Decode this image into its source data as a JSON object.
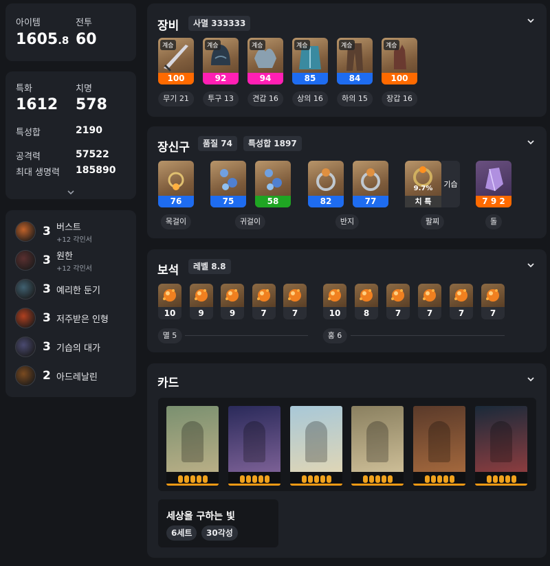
{
  "summary": {
    "item_label": "아이템",
    "item_level": "1605",
    "item_level_decimal": ".8",
    "combat_label": "전투",
    "combat_level": "60"
  },
  "stats": {
    "spec_label": "특화",
    "spec_value": "1612",
    "crit_label": "치명",
    "crit_value": "578",
    "trait_total_label": "특성합",
    "trait_total_value": "2190",
    "attack_label": "공격력",
    "attack_value": "57522",
    "max_hp_label": "최대 생명력",
    "max_hp_value": "185890"
  },
  "engravings": [
    {
      "level": "3",
      "name": "버스트",
      "sub": "+12 각인서",
      "icon": "burst-icon",
      "color": "#c0622a"
    },
    {
      "level": "3",
      "name": "원한",
      "sub": "+12 각인서",
      "icon": "grudge-icon",
      "color": "#5a3030"
    },
    {
      "level": "3",
      "name": "예리한 둔기",
      "sub": "",
      "icon": "keen-blunt-icon",
      "color": "#406070"
    },
    {
      "level": "3",
      "name": "저주받은 인형",
      "sub": "",
      "icon": "cursed-doll-icon",
      "color": "#b04020"
    },
    {
      "level": "3",
      "name": "기습의 대가",
      "sub": "",
      "icon": "ambush-icon",
      "color": "#4a4a70"
    },
    {
      "level": "2",
      "name": "아드레날린",
      "sub": "",
      "icon": "adrenaline-icon",
      "color": "#7a4a20"
    }
  ],
  "equipment": {
    "title": "장비",
    "tag": "사멸 333333",
    "items": [
      {
        "badge": "계승",
        "quality": "100",
        "bar": "orange",
        "label": "무기 21",
        "icon": "weapon-icon"
      },
      {
        "badge": "계승",
        "quality": "92",
        "bar": "pink",
        "label": "투구 13",
        "icon": "helmet-icon"
      },
      {
        "badge": "계승",
        "quality": "94",
        "bar": "pink",
        "label": "견갑 16",
        "icon": "shoulder-icon"
      },
      {
        "badge": "계승",
        "quality": "85",
        "bar": "blue",
        "label": "상의 16",
        "icon": "chest-icon"
      },
      {
        "badge": "계승",
        "quality": "84",
        "bar": "blue",
        "label": "하의 15",
        "icon": "pants-icon"
      },
      {
        "badge": "계승",
        "quality": "100",
        "bar": "orange",
        "label": "장갑 16",
        "icon": "gloves-icon"
      }
    ]
  },
  "accessories": {
    "title": "장신구",
    "tag1": "품질 74",
    "tag2": "특성합 1897",
    "items": [
      {
        "quality": "76",
        "bar": "blue",
        "icon": "necklace-icon"
      },
      {
        "quality": "75",
        "bar": "blue",
        "icon": "earring-icon"
      },
      {
        "quality": "58",
        "bar": "green",
        "icon": "earring-icon"
      },
      {
        "quality": "82",
        "bar": "blue",
        "icon": "ring-icon"
      },
      {
        "quality": "77",
        "bar": "blue",
        "icon": "ring-icon"
      }
    ],
    "bracelet": {
      "percent": "9.7%",
      "stats": "치 특",
      "side": "기습",
      "icon": "bracelet-icon"
    },
    "stone": {
      "value": "7 9 2",
      "icon": "ability-stone-icon"
    },
    "labels": {
      "necklace": "목걸이",
      "earring": "귀걸이",
      "ring": "반지",
      "bracelet": "팔찌",
      "stone": "돌"
    }
  },
  "gems": {
    "title": "보석",
    "tag": "레벨 8.8",
    "left": [
      "10",
      "9",
      "9",
      "7",
      "7"
    ],
    "right": [
      "10",
      "8",
      "7",
      "7",
      "7",
      "7"
    ],
    "left_label": "멸 5",
    "right_label": "홍 6"
  },
  "cards": {
    "title": "카드",
    "items": [
      {
        "name": "card-1",
        "stars": 5,
        "bg1": "#7a9070",
        "bg2": "#c4b48a"
      },
      {
        "name": "card-2",
        "stars": 5,
        "bg1": "#2a2a5a",
        "bg2": "#8a6aa0"
      },
      {
        "name": "card-3",
        "stars": 5,
        "bg1": "#a8c8d8",
        "bg2": "#e8d8b0"
      },
      {
        "name": "card-4",
        "stars": 5,
        "bg1": "#8a8060",
        "bg2": "#d8c8a0"
      },
      {
        "name": "card-5",
        "stars": 5,
        "bg1": "#5a3a2a",
        "bg2": "#b07040"
      },
      {
        "name": "card-6",
        "stars": 5,
        "bg1": "#1a2a3a",
        "bg2": "#a04040"
      }
    ],
    "set_name": "세상을 구하는 빛",
    "set_count": "6세트",
    "awaken": "30각성"
  }
}
